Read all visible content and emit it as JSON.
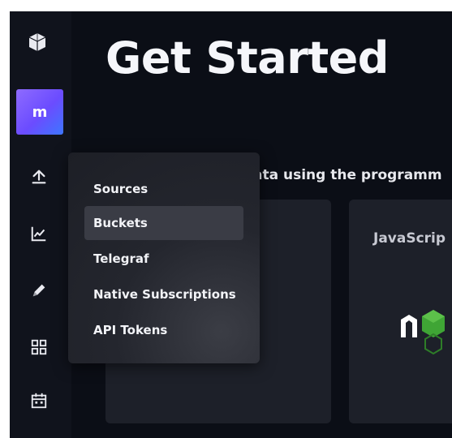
{
  "sidebar": {
    "org_initial": "m",
    "icons": [
      "graph-logo-icon",
      "upload-icon",
      "chart-line-icon",
      "pencil-icon",
      "grid-icon",
      "calendar-icon"
    ]
  },
  "main": {
    "title": "Get Started",
    "subtitle": "ata using the programm",
    "cards": [
      {
        "label": ""
      },
      {
        "label": "JavaScrip"
      }
    ]
  },
  "menu": {
    "items": [
      {
        "label": "Sources"
      },
      {
        "label": "Buckets",
        "active": true
      },
      {
        "label": "Telegraf"
      },
      {
        "label": "Native Subscriptions"
      },
      {
        "label": "API Tokens"
      }
    ]
  },
  "colors": {
    "background": "#0b0e16",
    "sidebar": "#10131c",
    "card": "#1d2029",
    "menu": "#24262e",
    "avatar_gradient_start": "#8e6bff",
    "avatar_gradient_end": "#3d76ff",
    "node_green": "#3fa535"
  }
}
